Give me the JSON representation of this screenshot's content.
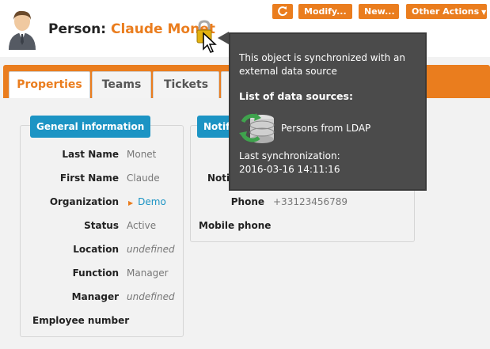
{
  "header": {
    "title_prefix": "Person:",
    "title_name": "Claude Monet"
  },
  "toolbar": {
    "refresh_icon": "refresh-icon",
    "modify_label": "Modify...",
    "new_label": "New...",
    "other_label": "Other Actions"
  },
  "tabs": [
    {
      "label": "Properties",
      "active": true
    },
    {
      "label": "Teams",
      "active": false
    },
    {
      "label": "Tickets",
      "active": false
    }
  ],
  "general": {
    "legend": "General information",
    "fields": [
      {
        "label": "Last Name",
        "value": "Monet"
      },
      {
        "label": "First Name",
        "value": "Claude"
      },
      {
        "label": "Organization",
        "value": "Demo"
      },
      {
        "label": "Status",
        "value": "Active"
      },
      {
        "label": "Location",
        "value": "undefined"
      },
      {
        "label": "Function",
        "value": "Manager"
      },
      {
        "label": "Manager",
        "value": "undefined"
      },
      {
        "label": "Employee number",
        "value": ""
      }
    ]
  },
  "notification": {
    "legend_partial": "Notifi",
    "fields": [
      {
        "label": "Notif",
        "value": ""
      },
      {
        "label": "Phone",
        "value": "+33123456789"
      },
      {
        "label": "Mobile phone",
        "value": ""
      }
    ]
  },
  "tooltip": {
    "description": "This object is synchronized with an external data source",
    "list_title": "List of data sources:",
    "source_name": "Persons from LDAP",
    "last_sync_label": "Last synchronization:",
    "last_sync_value": "2016-03-16 14:11:16"
  },
  "colors": {
    "accent": "#ea7d1e",
    "legend": "#1c94c4",
    "tooltip_bg": "#4b4b4b"
  }
}
